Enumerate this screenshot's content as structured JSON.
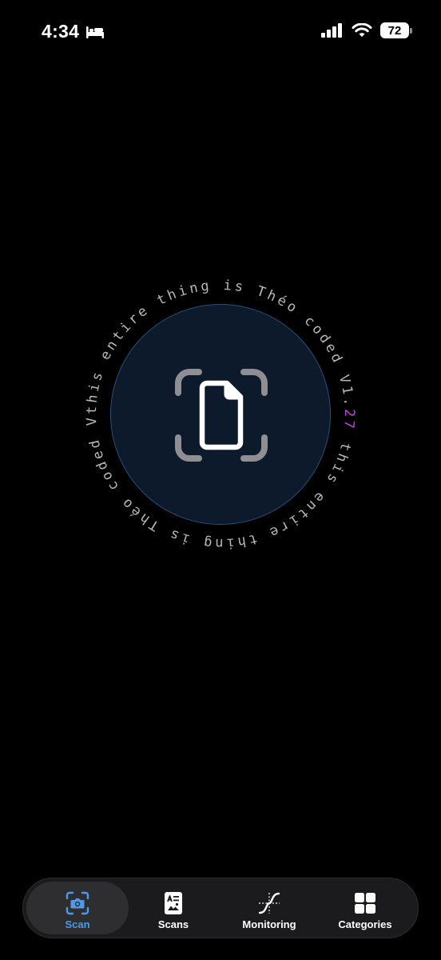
{
  "status_bar": {
    "time": "4:34",
    "sleep_icon": "bed-icon",
    "signal_icon": "cellular-signal-icon",
    "wifi_icon": "wifi-icon",
    "battery_level": "72"
  },
  "scan": {
    "ring_text_prefix": "this entire thing is Théo coded V1.",
    "ring_text_version": "27",
    "version_color": "#c23fe0",
    "ring_text_color": "#b8b8b8",
    "circle_fill": "#0c1a2c",
    "circle_border": "#27507a",
    "icon": "document-scan-icon"
  },
  "tab_bar": {
    "active_color": "#4a9aed",
    "tabs": [
      {
        "label": "Scan",
        "icon": "camera-viewfinder-icon",
        "active": true
      },
      {
        "label": "Scans",
        "icon": "scanned-document-icon",
        "active": false
      },
      {
        "label": "Monitoring",
        "icon": "curve-chart-icon",
        "active": false
      },
      {
        "label": "Categories",
        "icon": "grid-icon",
        "active": false
      }
    ]
  }
}
